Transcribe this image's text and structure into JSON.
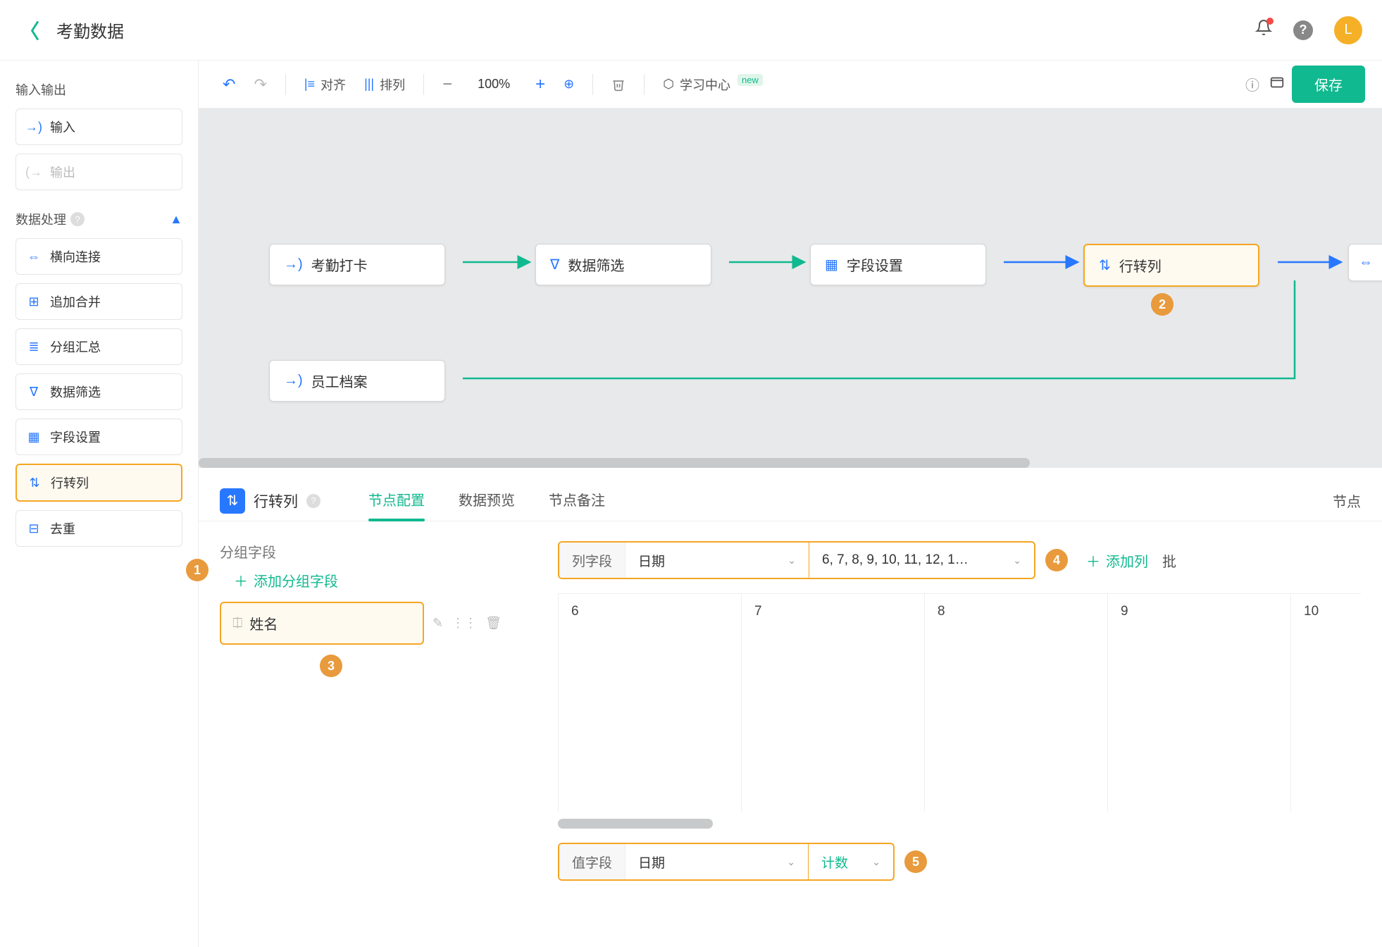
{
  "header": {
    "title": "考勤数据",
    "avatar_letter": "L"
  },
  "sidebar": {
    "io_title": "输入输出",
    "input_label": "输入",
    "output_label": "输出",
    "process_title": "数据处理",
    "items": [
      {
        "icon": "⇔",
        "label": "横向连接"
      },
      {
        "icon": "⊞",
        "label": "追加合并"
      },
      {
        "icon": "≣",
        "label": "分组汇总"
      },
      {
        "icon": "∇",
        "label": "数据筛选"
      },
      {
        "icon": "▦",
        "label": "字段设置"
      },
      {
        "icon": "⇅",
        "label": "行转列",
        "highlighted": true
      },
      {
        "icon": "⊟",
        "label": "去重"
      }
    ]
  },
  "toolbar": {
    "align_label": "对齐",
    "arrange_label": "排列",
    "zoom": "100%",
    "learn_label": "学习中心",
    "learn_badge": "new",
    "save_label": "保存"
  },
  "canvas": {
    "nodes": {
      "attendance": "考勤打卡",
      "filter": "数据筛选",
      "field": "字段设置",
      "pivot": "行转列",
      "employee": "员工档案"
    }
  },
  "panel": {
    "title": "行转列",
    "tabs": {
      "config": "节点配置",
      "preview": "数据预览",
      "note": "节点备注"
    },
    "right_label": "节点",
    "group_label": "分组字段",
    "add_group": "添加分组字段",
    "group_field": "姓名",
    "col_label": "列字段",
    "col_field": "日期",
    "col_values": "6, 7, 8, 9, 10, 11, 12, 1…",
    "add_col": "添加列",
    "batch": "批",
    "columns": [
      "6",
      "7",
      "8",
      "9",
      "10"
    ],
    "val_label": "值字段",
    "val_field": "日期",
    "agg": "计数"
  },
  "callouts": {
    "c1": "1",
    "c2": "2",
    "c3": "3",
    "c4": "4",
    "c5": "5"
  }
}
